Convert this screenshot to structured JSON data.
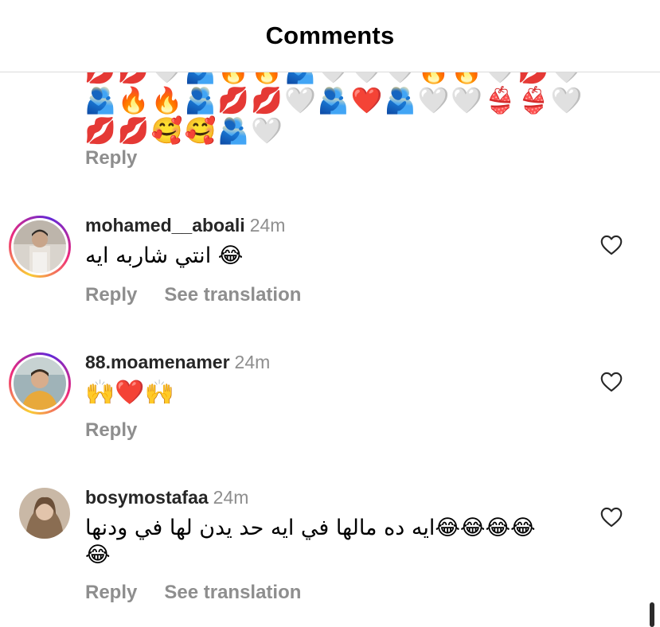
{
  "header": {
    "title": "Comments"
  },
  "top_comment": {
    "emoji_rows": [
      "💋💋🤍🫂🔥🔥🫂🤍🤍🤍🔥🔥🤍💋🤍",
      "🫂🔥🔥🫂💋💋🤍🫂❤️🫂🤍🤍👙👙🤍",
      "💋💋🥰🥰🫂🤍"
    ],
    "reply_label": "Reply"
  },
  "comments": [
    {
      "username": "mohamed__aboali",
      "time": "24m",
      "text": "انتي شاربه ايه 😂",
      "reply_label": "Reply",
      "translate_label": "See translation"
    },
    {
      "username": "88.moamenamer",
      "time": "24m",
      "text": "🙌❤️🙌",
      "reply_label": "Reply"
    },
    {
      "username": "bosymostafaa",
      "time": "24m",
      "text_line1": "ايه ده مالها في ايه حد يدن لها في ودنها😂😂😂😂",
      "text_line2": "😂",
      "reply_label": "Reply",
      "translate_label": "See translation"
    }
  ],
  "icons": {
    "like": "heart-outline-icon"
  },
  "colors": {
    "secondary_text": "#8e8e8e",
    "divider": "#dbdbdb",
    "story_ring_start": "#f9ce34",
    "story_ring_mid": "#ee2a7b"
  }
}
